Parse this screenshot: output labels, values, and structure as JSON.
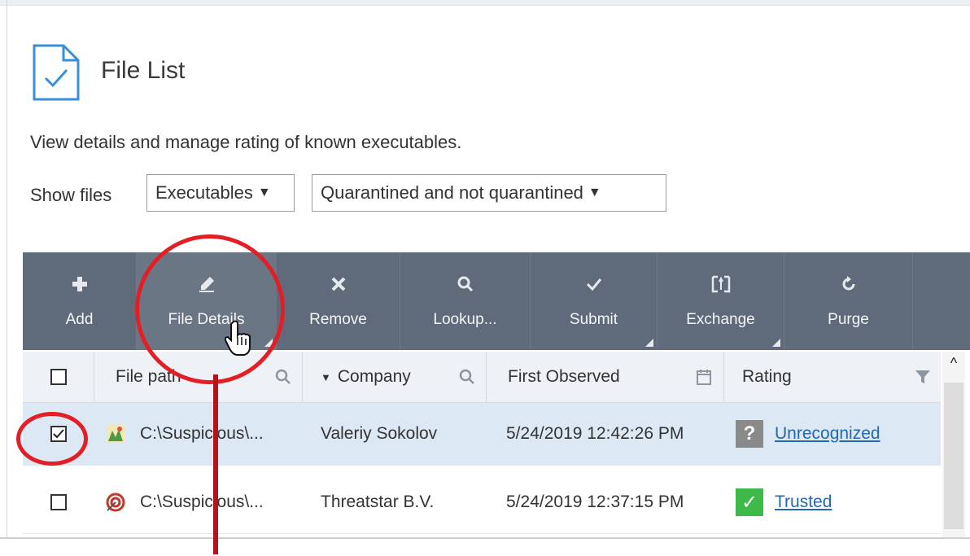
{
  "header": {
    "title": "File List",
    "description": "View details and manage rating of known executables."
  },
  "filters": {
    "label": "Show files",
    "type_select": "Executables",
    "quarantine_select": "Quarantined and not quarantined"
  },
  "toolbar": {
    "items": [
      {
        "label": "Add",
        "icon": "plus-icon"
      },
      {
        "label": "File Details",
        "icon": "pencil-icon"
      },
      {
        "label": "Remove",
        "icon": "x-icon"
      },
      {
        "label": "Lookup...",
        "icon": "search-icon"
      },
      {
        "label": "Submit",
        "icon": "check-icon"
      },
      {
        "label": "Exchange",
        "icon": "exchange-icon"
      },
      {
        "label": "Purge",
        "icon": "refresh-icon"
      }
    ]
  },
  "table": {
    "columns": [
      "File path",
      "Company",
      "First Observed",
      "Rating"
    ],
    "rows": [
      {
        "path": "C:\\Suspicious\\...",
        "company": "Valeriy Sokolov",
        "observed": "5/24/2019 12:42:26 PM",
        "rating": "Unrecognized",
        "rating_badge": "?",
        "checked": true
      },
      {
        "path": "C:\\Suspicious\\...",
        "company": "Threatstar B.V.",
        "observed": "5/24/2019 12:37:15 PM",
        "rating": "Trusted",
        "rating_badge": "✓",
        "checked": false
      }
    ]
  },
  "colors": {
    "toolbar_bg": "#5f6b7a",
    "selected_row": "#dce9f5",
    "annotation": "#e41e26",
    "trusted": "#3db94a",
    "unrecognized": "#8a8a8a",
    "link": "#2468b0"
  }
}
